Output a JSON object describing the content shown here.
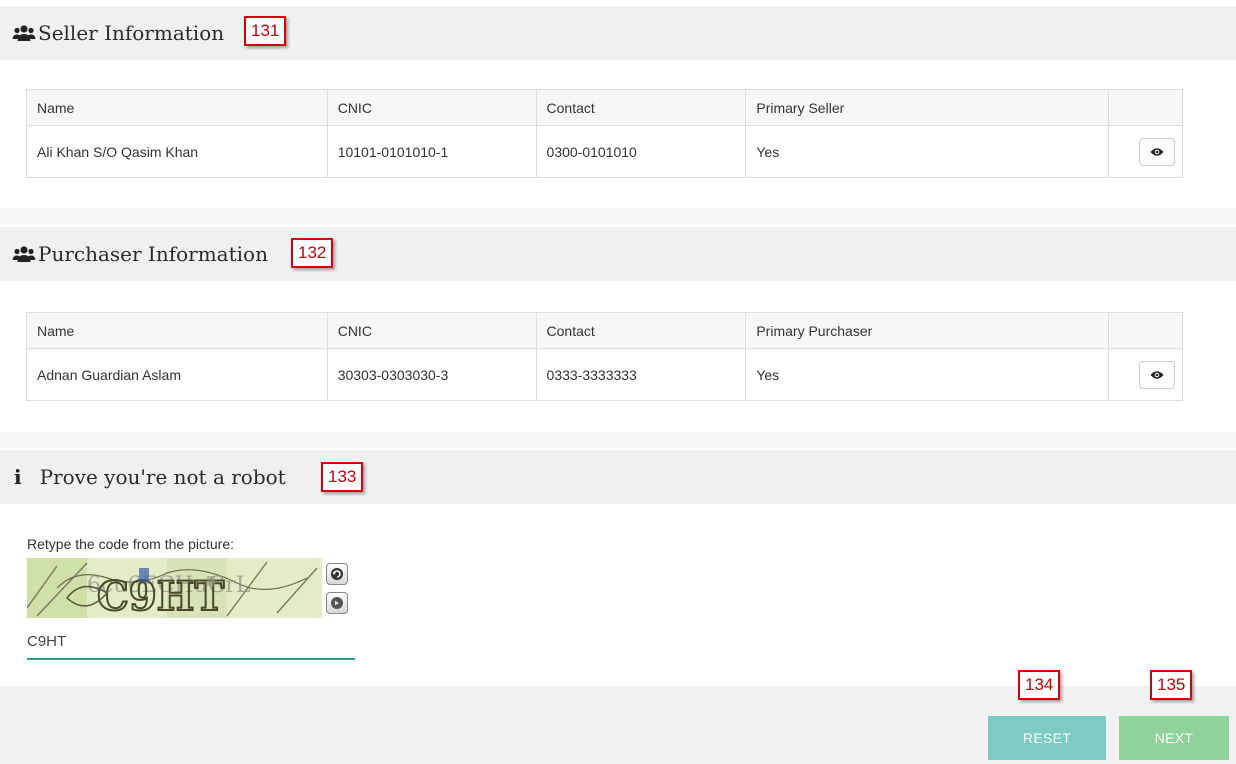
{
  "seller": {
    "title": "Seller Information",
    "annotation": "131",
    "headers": [
      "Name",
      "CNIC",
      "Contact",
      "Primary Seller"
    ],
    "rows": [
      {
        "name": "Ali Khan S/O Qasim Khan",
        "cnic": "10101-0101010-1",
        "contact": "0300-0101010",
        "primary": "Yes"
      }
    ]
  },
  "purchaser": {
    "title": "Purchaser Information",
    "annotation": "132",
    "headers": [
      "Name",
      "CNIC",
      "Contact",
      "Primary Purchaser"
    ],
    "rows": [
      {
        "name": "Adnan Guardian Aslam",
        "cnic": "30303-0303030-3",
        "contact": "0333-3333333",
        "primary": "Yes"
      }
    ]
  },
  "robot": {
    "title": "Prove you're not a robot",
    "annotation": "133",
    "label": "Retype the code from the picture:",
    "captcha_text": "C9HT",
    "input_value": "C9HT"
  },
  "actions": {
    "reset_label": "RESET",
    "reset_annotation": "134",
    "next_label": "NEXT",
    "next_annotation": "135"
  },
  "icons": {
    "users": "users-icon",
    "info": "info-icon",
    "eye": "eye-icon",
    "refresh": "refresh-icon",
    "audio": "audio-icon"
  },
  "colors": {
    "reset": "#7ecbc4",
    "next": "#8fd29a",
    "annotation": "#d9000d",
    "input_underline": "#2e9c86"
  }
}
